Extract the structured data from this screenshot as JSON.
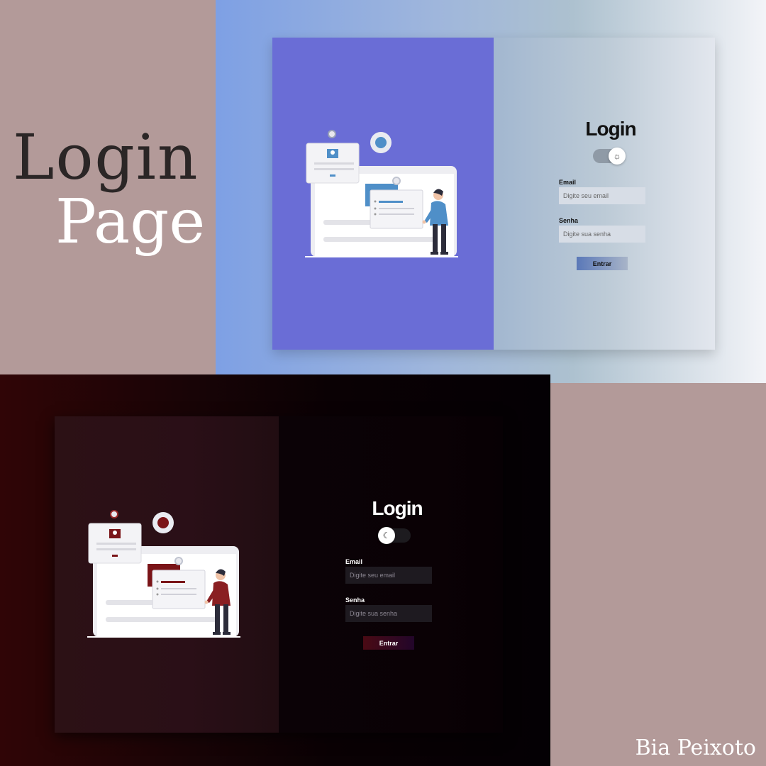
{
  "showcase": {
    "title_line1": "Login",
    "title_line2": "Page",
    "credit": "Bia Peixoto"
  },
  "light_theme": {
    "title": "Login",
    "toggle_icon": "sun-icon",
    "toggle_glyph": "☼",
    "email_label": "Email",
    "email_placeholder": "Digite seu email",
    "password_label": "Senha",
    "password_placeholder": "Digite sua senha",
    "submit_label": "Entrar",
    "colors": {
      "accent": "#6a6dd6",
      "person_shirt": "#4f8fc8",
      "card_badge": "#4f8fc8"
    }
  },
  "dark_theme": {
    "title": "Login",
    "toggle_icon": "moon-icon",
    "toggle_glyph": "☾",
    "email_label": "Email",
    "email_placeholder": "Digite seu email",
    "password_label": "Senha",
    "password_placeholder": "Digite sua senha",
    "submit_label": "Entrar",
    "colors": {
      "accent": "#2c1115",
      "person_shirt": "#8a1f22",
      "card_badge": "#7a1418"
    }
  }
}
